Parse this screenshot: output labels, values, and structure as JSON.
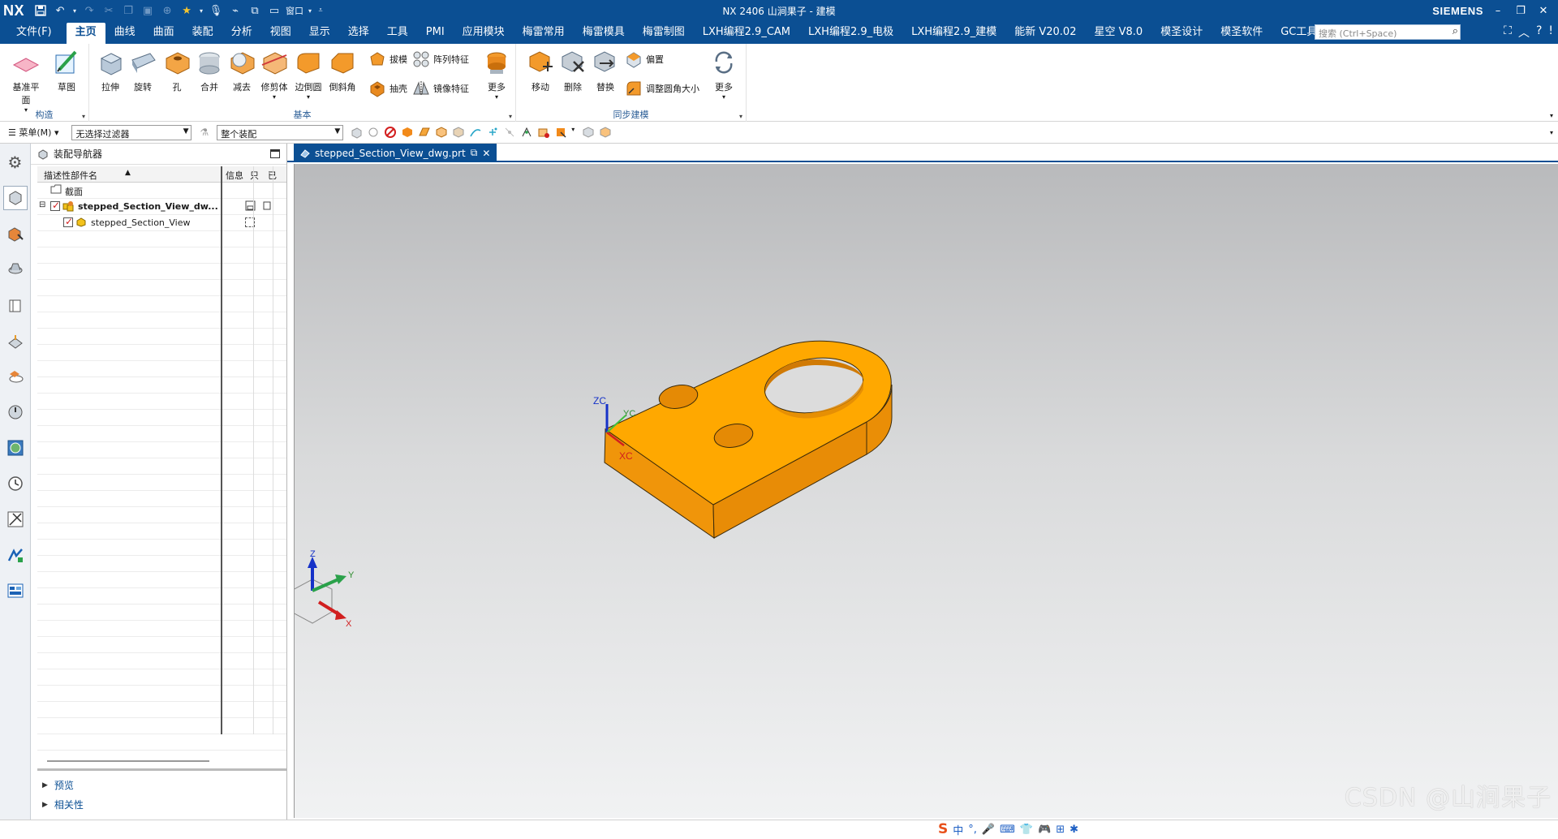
{
  "titlebar": {
    "logo": "NX",
    "title": "NX 2406 山涧果子 - 建模",
    "brand": "SIEMENS",
    "window_label": "窗口",
    "controls": [
      "–",
      "❐",
      "✕"
    ]
  },
  "menu": {
    "file": "文件(F)",
    "tabs": [
      "主页",
      "曲线",
      "曲面",
      "装配",
      "分析",
      "视图",
      "显示",
      "选择",
      "工具",
      "PMI",
      "应用模块",
      "梅雷常用",
      "梅雷模具",
      "梅雷制图",
      "LXH编程2.9_CAM",
      "LXH编程2.9_电极",
      "LXH编程2.9_建模",
      "能新 V20.02",
      "星空 V8.0",
      "模圣设计",
      "模圣软件",
      "GC工具箱"
    ],
    "active_tab": "主页",
    "search_placeholder": "搜索 (Ctrl+Space)"
  },
  "ribbon": {
    "group_construct": {
      "label": "构造",
      "buttons": [
        "基准平面",
        "草图"
      ]
    },
    "group_basic": {
      "label": "基本",
      "buttons": [
        "拉伸",
        "旋转",
        "孔",
        "合并",
        "减去",
        "修剪体",
        "边倒圆",
        "倒斜角"
      ],
      "small": [
        "拔模",
        "阵列特征",
        "抽壳",
        "镜像特征"
      ],
      "more": "更多"
    },
    "group_sync": {
      "label": "同步建模",
      "buttons": [
        "移动",
        "删除",
        "替换"
      ],
      "small": [
        "偏置",
        "调整圆角大小"
      ],
      "more": "更多"
    }
  },
  "selection_bar": {
    "menu": "菜单(M)",
    "filter": "无选择过滤器",
    "scope": "整个装配"
  },
  "navigator": {
    "title": "装配导航器",
    "columns": [
      "描述性部件名",
      "信息",
      "只",
      "已"
    ],
    "rows": [
      {
        "name": "截面",
        "type": "folder"
      },
      {
        "name": "stepped_Section_View_dw...",
        "type": "assembly",
        "checked": true
      },
      {
        "name": "stepped_Section_View",
        "type": "part",
        "checked": true
      }
    ],
    "sections": [
      "预览",
      "相关性"
    ]
  },
  "graphics": {
    "tab_label": "stepped_Section_View_dwg.prt",
    "wcs": {
      "zc": "ZC",
      "yc": "YC",
      "xc": "XC"
    },
    "triad": {
      "z": "Z",
      "y": "Y",
      "x": "X"
    },
    "part_color": "#ffa500"
  },
  "statusbar": {
    "ime": [
      "中",
      "°,",
      "🎤",
      "⌨",
      "👕",
      "🎮",
      "⊞",
      "✱"
    ]
  },
  "watermark": "CSDN @山涧果子"
}
